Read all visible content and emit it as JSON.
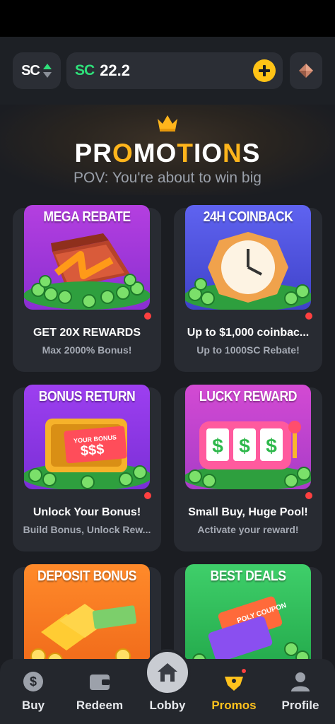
{
  "wallet": {
    "currency_code": "SC",
    "balance_code": "SC",
    "balance": "22.2"
  },
  "hero": {
    "title_parts": [
      "PR",
      "O",
      "MO",
      "T",
      "IO",
      "N",
      "S"
    ],
    "subtitle": "POV: You're about to win big"
  },
  "promotions": [
    {
      "art_title": "MEGA REBATE",
      "headline": "GET 20X REWARDS",
      "subline": "Max 2000% Bonus!",
      "badge": true
    },
    {
      "art_title": "24H COINBACK",
      "headline": "Up to $1,000 coinbac...",
      "subline": "Up to 1000SC Rebate!",
      "badge": true
    },
    {
      "art_title": "BONUS RETURN",
      "art_text": "YOUR BONUS",
      "art_money": "$$$",
      "headline": "Unlock Your Bonus!",
      "subline": "Build Bonus, Unlock Rew...",
      "badge": true
    },
    {
      "art_title": "LUCKY REWARD",
      "headline": "Small Buy, Huge Pool!",
      "subline": "Activate your reward!",
      "badge": true
    },
    {
      "art_title": "DEPOSIT BONUS",
      "headline": "",
      "subline": "",
      "badge": false
    },
    {
      "art_title": "BEST DEALS",
      "art_text": "POLY COUPON",
      "headline": "",
      "subline": "",
      "badge": false
    }
  ],
  "nav": {
    "items": [
      {
        "label": "Buy",
        "icon": "dollar-coin-icon"
      },
      {
        "label": "Redeem",
        "icon": "wallet-icon"
      },
      {
        "label": "Lobby",
        "icon": "home-icon"
      },
      {
        "label": "Promos",
        "icon": "promo-ticket-icon"
      },
      {
        "label": "Profile",
        "icon": "person-icon"
      }
    ],
    "active": "Promos"
  },
  "colors": {
    "accent_yellow": "#ffc316",
    "sc_green": "#2fe07a",
    "badge_red": "#ff4040",
    "background": "#1b1d22",
    "card": "#282b32"
  }
}
